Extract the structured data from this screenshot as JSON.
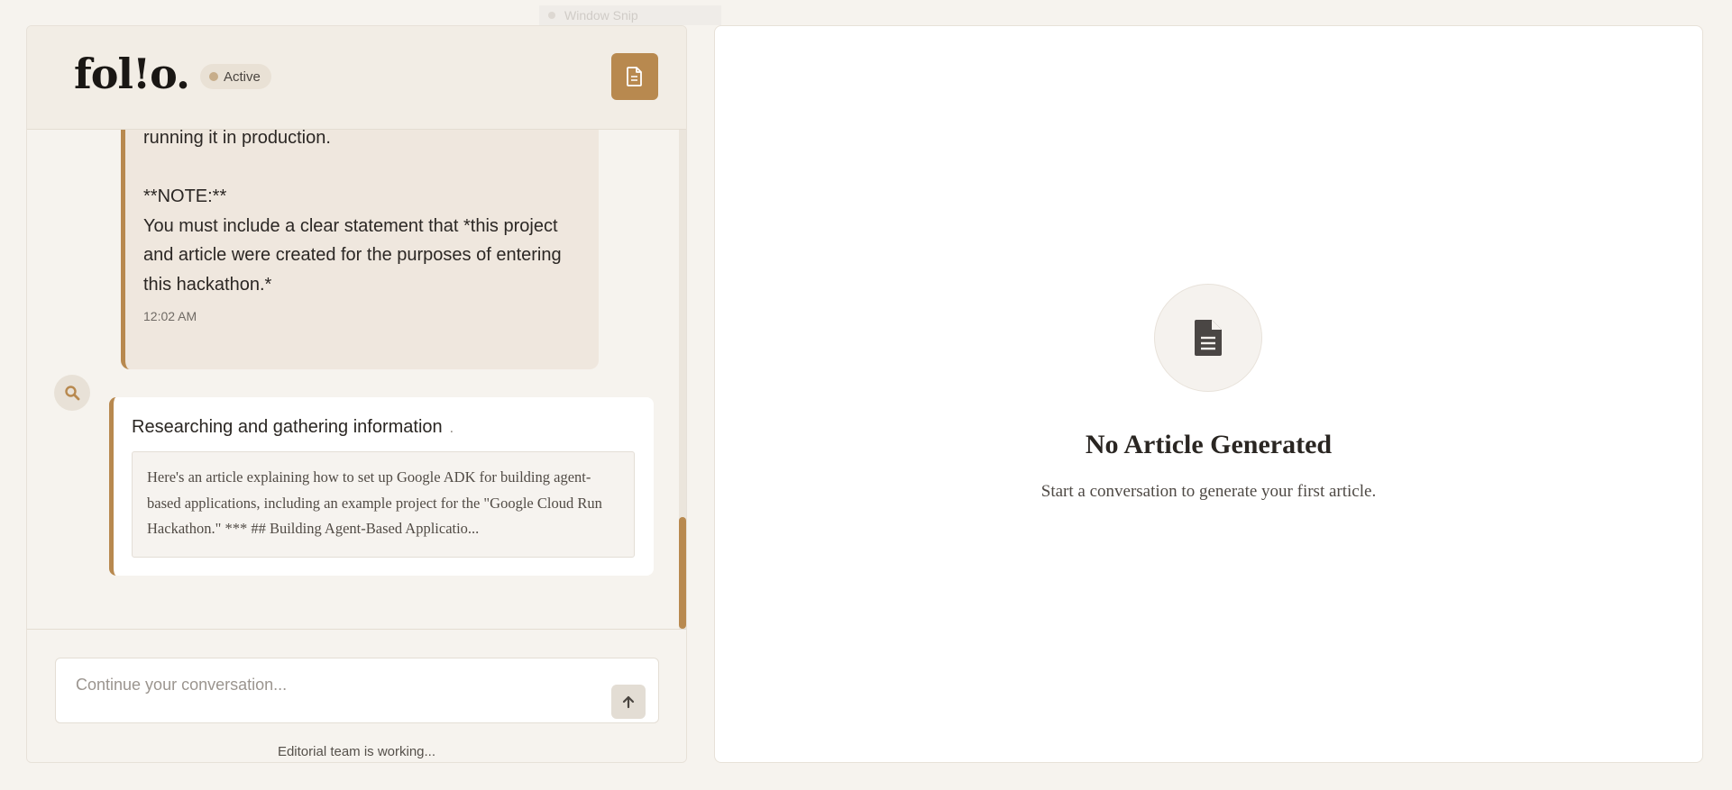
{
  "overlay": {
    "snip_label": "Window Snip"
  },
  "header": {
    "logo": "fol!o.",
    "status": "Active"
  },
  "messages": {
    "user": {
      "body": "running it in production.\n\n**NOTE:**\nYou must include a clear statement that *this project and article were created for the purposes of entering this hackathon.*",
      "time": "12:02 AM"
    },
    "agent": {
      "heading": "Researching and gathering information",
      "heading_dot": ".",
      "excerpt": "Here's an article explaining how to set up Google ADK for building agent-based applications, including an example project for the \"Google Cloud Run Hackathon.\" *** ## Building Agent-Based Applicatio..."
    }
  },
  "composer": {
    "placeholder": "Continue your conversation...",
    "status": "Editorial team is working..."
  },
  "article": {
    "empty_title": "No Article Generated",
    "empty_subtitle": "Start a conversation to generate your first article."
  },
  "colors": {
    "accent": "#b8894f",
    "background": "#f6f3ee",
    "status_dot": "#c7ad8a"
  },
  "icons": {
    "header_button": "document-icon",
    "agent_avatar": "search-icon",
    "send": "arrow-up-icon",
    "empty_state": "document-icon"
  }
}
